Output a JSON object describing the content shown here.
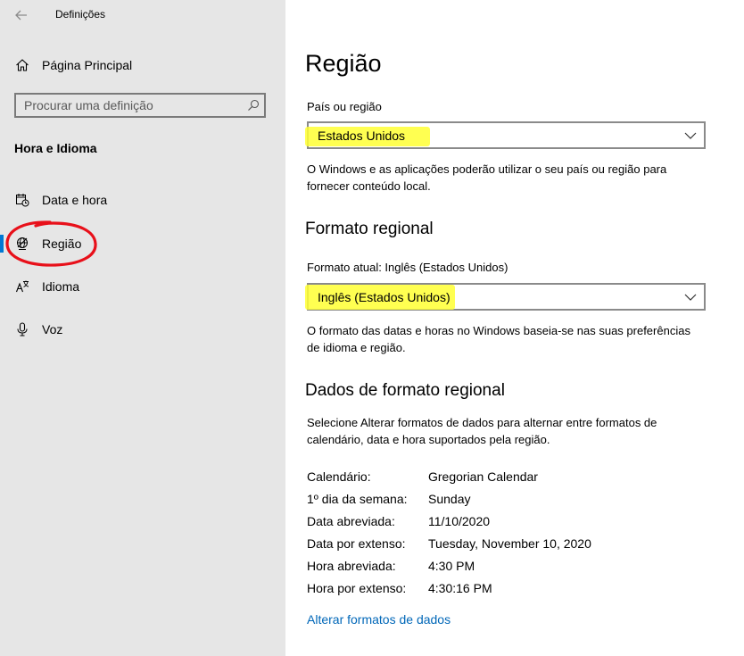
{
  "header": {
    "title": "Definições"
  },
  "sidebar": {
    "home_label": "Página Principal",
    "search_placeholder": "Procurar uma definição",
    "section_heading": "Hora e Idioma",
    "items": [
      {
        "label": "Data e hora",
        "icon": "calendar-clock-icon"
      },
      {
        "label": "Região",
        "icon": "globe-icon",
        "selected": true
      },
      {
        "label": "Idioma",
        "icon": "language-icon"
      },
      {
        "label": "Voz",
        "icon": "microphone-icon"
      }
    ]
  },
  "main": {
    "title": "Região",
    "country": {
      "label": "País ou região",
      "value": "Estados Unidos",
      "description": "O Windows e as aplicações poderão utilizar o seu país ou região para fornecer conteúdo local."
    },
    "regional_format": {
      "title": "Formato regional",
      "current_label": "Formato atual: Inglês (Estados Unidos)",
      "value": "Inglês (Estados Unidos)",
      "description": "O formato das datas e horas no Windows baseia-se nas suas preferências de idioma e região."
    },
    "regional_data": {
      "title": "Dados de formato regional",
      "description": "Selecione Alterar formatos de dados para alternar entre formatos de calendário, data e hora suportados pela região.",
      "rows": [
        {
          "key": "Calendário:",
          "value": "Gregorian Calendar"
        },
        {
          "key": "1º dia da semana:",
          "value": "Sunday"
        },
        {
          "key": "Data abreviada:",
          "value": "11/10/2020"
        },
        {
          "key": "Data por extenso:",
          "value": "Tuesday, November 10, 2020"
        },
        {
          "key": "Hora abreviada:",
          "value": "4:30 PM"
        },
        {
          "key": "Hora por extenso:",
          "value": "4:30:16 PM"
        }
      ],
      "change_link": "Alterar formatos de dados"
    }
  },
  "colors": {
    "sidebar_bg": "#e6e6e6",
    "accent": "#0078d4",
    "link": "#0067b8",
    "highlight": "#ffff33",
    "annotation": "#e8101a"
  }
}
